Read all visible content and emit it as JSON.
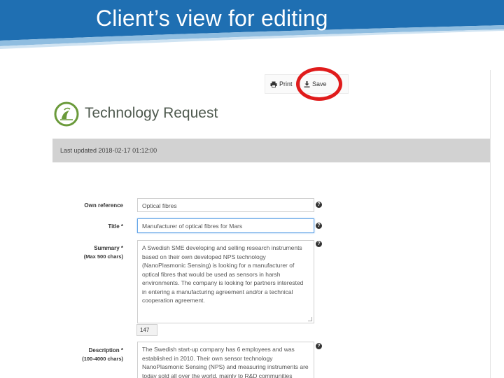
{
  "slide": {
    "title": "Client’s view for editing",
    "header_color": "#1f6fb2"
  },
  "toolbar": {
    "print_label": "Print",
    "save_label": "Save"
  },
  "app": {
    "title": "Technology Request",
    "last_updated": "Last updated 2018-02-17 01:12:00"
  },
  "form": {
    "own_reference": {
      "label": "Own reference",
      "value": "Optical fibres"
    },
    "title": {
      "label": "Title *",
      "value": "Manufacturer of optical fibres for Mars"
    },
    "summary": {
      "label": "Summary *",
      "hint": "(Max 500 chars)",
      "value": "A Swedish SME developing and selling research instruments based on their own developed NPS technology (NanoPlasmonic Sensing) is looking for a manufacturer of optical fibres that would be used as sensors in harsh environments. The company is looking for partners interested in entering a manufacturing agreement and/or a technical cooperation agreement.",
      "char_count": "147"
    },
    "description": {
      "label": "Description *",
      "hint": "(100-4000 chars)",
      "value": "The Swedish start-up company has 6 employees and was established in 2010. Their own sensor technology NanoPlasmonic Sensing (NPS) and measuring instruments are today sold all over the world, mainly to R&D communities"
    }
  },
  "icons": {
    "help": "?"
  }
}
